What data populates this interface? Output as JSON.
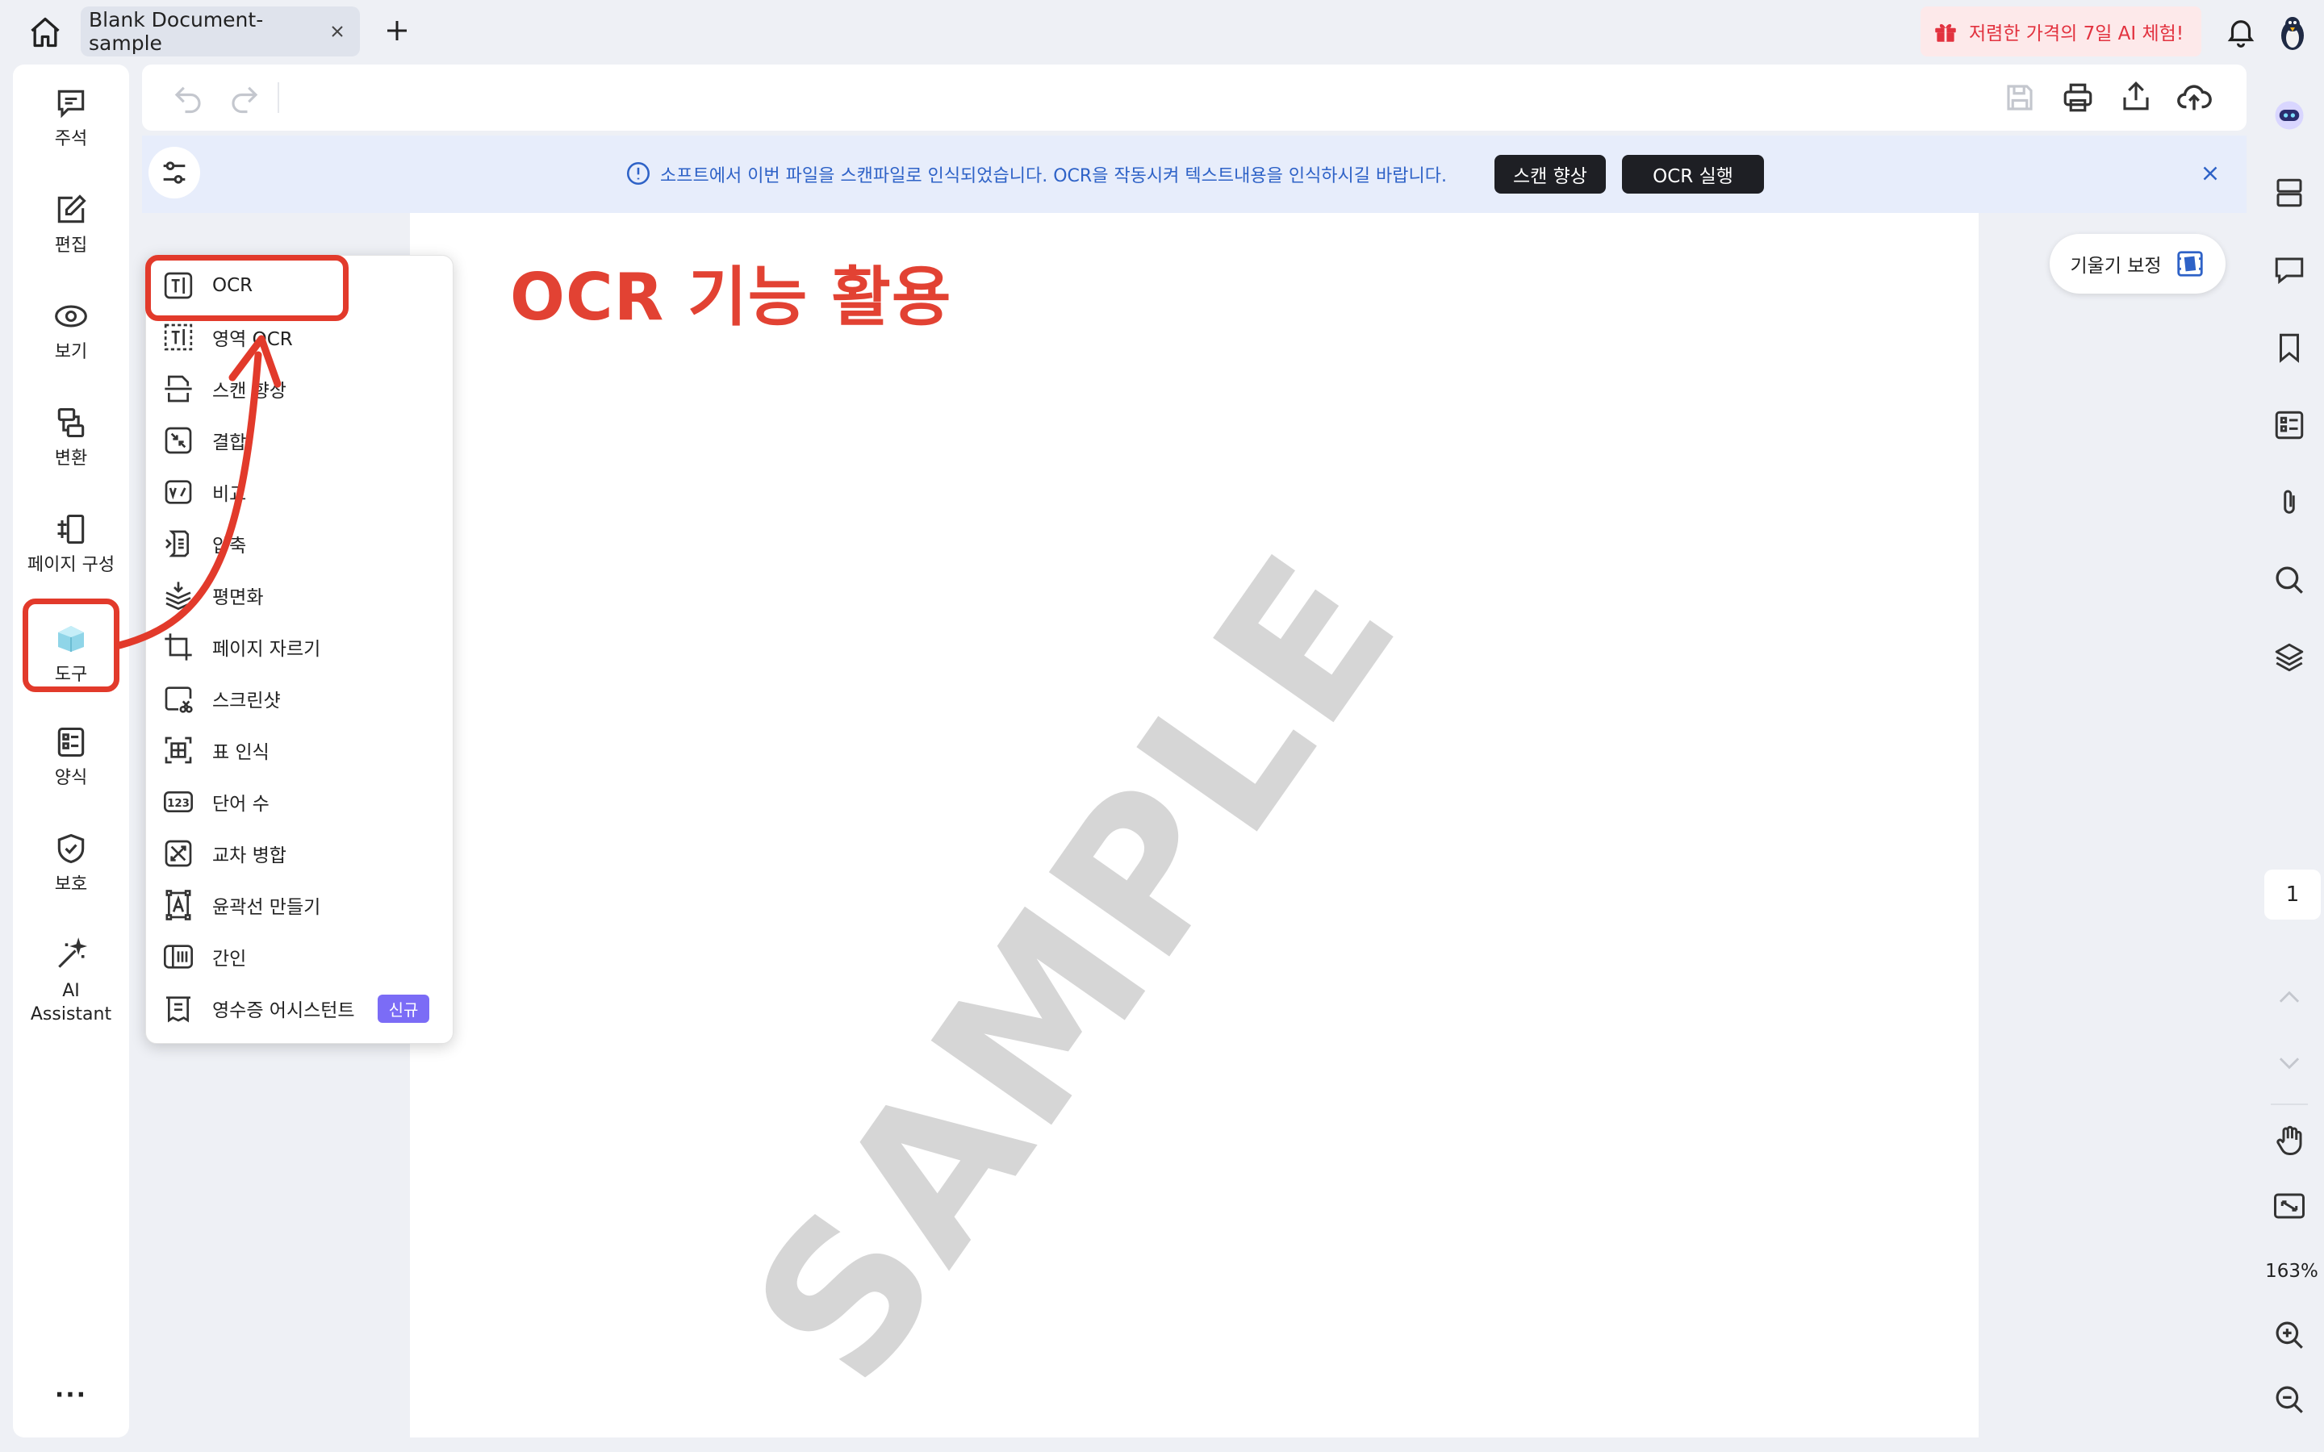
{
  "tab": {
    "title": "Blank Document-sample"
  },
  "promo": {
    "text": "저렴한 가격의 7일 AI 체험!"
  },
  "left_sidebar": {
    "items": [
      {
        "label": "주석"
      },
      {
        "label": "편집"
      },
      {
        "label": "보기"
      },
      {
        "label": "변환"
      },
      {
        "label": "페이지 구성"
      },
      {
        "label": "도구"
      },
      {
        "label": "양식"
      },
      {
        "label": "보호"
      },
      {
        "label": "AI\nAssistant"
      }
    ],
    "more": "···"
  },
  "notice": {
    "text": "소프트에서 이번 파일을 스캔파일로 인식되었습니다. OCR을 작동시켜 텍스트내용을 인식하시길 바랍니다.",
    "enhance_button": "스캔 향상",
    "ocr_button": "OCR 실행"
  },
  "document": {
    "heading": "OCR 기능 활용",
    "watermark": "SAMPLE",
    "skew_button": "기울기 보정"
  },
  "tools_menu": {
    "items": [
      {
        "label": "OCR"
      },
      {
        "label": "영역 OCR"
      },
      {
        "label": "스캔 향상"
      },
      {
        "label": "결합"
      },
      {
        "label": "비교"
      },
      {
        "label": "압축"
      },
      {
        "label": "평면화"
      },
      {
        "label": "페이지 자르기"
      },
      {
        "label": "스크린샷"
      },
      {
        "label": "표 인식"
      },
      {
        "label": "단어 수"
      },
      {
        "label": "교차 병합"
      },
      {
        "label": "윤곽선 만들기"
      },
      {
        "label": "간인"
      },
      {
        "label": "영수증 어시스턴트",
        "badge": "신규"
      }
    ]
  },
  "right_sidebar": {
    "page_number": "1",
    "zoom": "163%"
  },
  "colors": {
    "accent_red": "#e23a2b",
    "notice_blue": "#2e62c7",
    "badge_purple": "#7b6cf6"
  }
}
